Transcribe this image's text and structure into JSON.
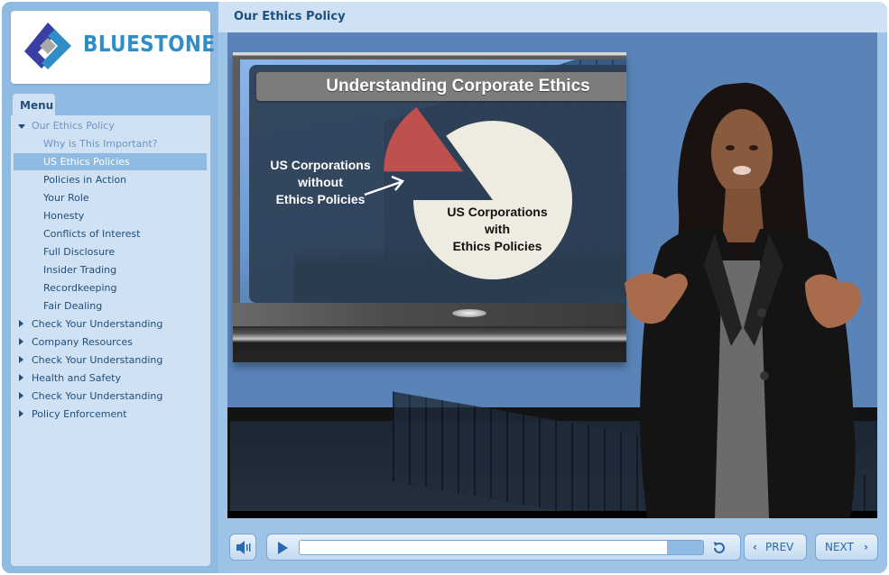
{
  "brand": {
    "name": "BLUESTONE",
    "colors": {
      "dark_blue": "#3a3fa5",
      "light_blue": "#2f8ec6",
      "gray": "#a9a9a9"
    }
  },
  "sidebar": {
    "menu_tab_label": "Menu",
    "items": [
      {
        "label": "Our Ethics Policy",
        "level": "top",
        "expanded": true,
        "state": "visited"
      },
      {
        "label": "Why is This Important?",
        "level": "sub",
        "state": "visited"
      },
      {
        "label": "US Ethics Policies",
        "level": "sub",
        "state": "selected"
      },
      {
        "label": "Policies in Action",
        "level": "sub",
        "state": "normal"
      },
      {
        "label": "Your Role",
        "level": "sub",
        "state": "normal"
      },
      {
        "label": "Honesty",
        "level": "sub",
        "state": "normal"
      },
      {
        "label": "Conflicts of Interest",
        "level": "sub",
        "state": "normal"
      },
      {
        "label": "Full Disclosure",
        "level": "sub",
        "state": "normal"
      },
      {
        "label": "Insider Trading",
        "level": "sub",
        "state": "normal"
      },
      {
        "label": "Recordkeeping",
        "level": "sub",
        "state": "normal"
      },
      {
        "label": "Fair Dealing",
        "level": "sub",
        "state": "normal"
      },
      {
        "label": "Check Your Understanding",
        "level": "top",
        "expanded": false,
        "state": "normal"
      },
      {
        "label": "Company Resources",
        "level": "top",
        "expanded": false,
        "state": "normal"
      },
      {
        "label": "Check Your Understanding",
        "level": "top",
        "expanded": false,
        "state": "normal"
      },
      {
        "label": "Health and Safety",
        "level": "top",
        "expanded": false,
        "state": "normal"
      },
      {
        "label": "Check Your Understanding",
        "level": "top",
        "expanded": false,
        "state": "normal"
      },
      {
        "label": "Policy Enforcement",
        "level": "top",
        "expanded": false,
        "state": "normal"
      }
    ]
  },
  "header": {
    "title": "Our Ethics Policy"
  },
  "slide": {
    "title": "Understanding Corporate Ethics"
  },
  "chart_data": {
    "type": "pie",
    "title": "Understanding Corporate Ethics",
    "slices": [
      {
        "label": "US Corporations with Ethics Policies",
        "label_lines": [
          "US Corporations",
          "with",
          "Ethics Policies"
        ],
        "value": 85,
        "color": "#eeebe1",
        "exploded": false
      },
      {
        "label": "US Corporations without Ethics Policies",
        "label_lines": [
          "US Corporations",
          "without",
          "Ethics Policies"
        ],
        "value": 15,
        "color": "#c0504d",
        "exploded": true
      }
    ],
    "annotation": "arrow pointing from 'without' label to red slice"
  },
  "player": {
    "progress_percent": 91,
    "prev_label": "PREV",
    "next_label": "NEXT",
    "icons": {
      "volume": "speaker-icon",
      "play": "play-icon",
      "replay": "replay-icon",
      "prev": "chevron-left-icon",
      "next": "chevron-right-icon"
    }
  }
}
